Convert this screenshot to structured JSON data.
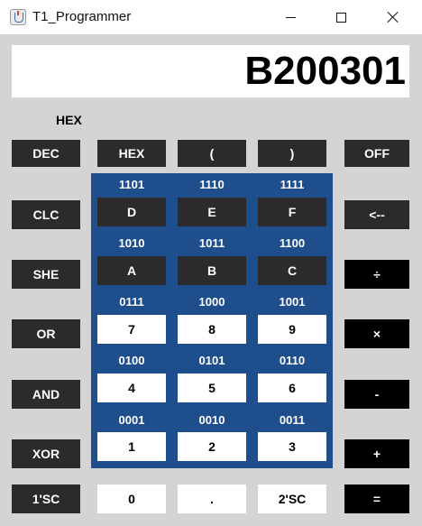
{
  "window": {
    "title": "T1_Programmer",
    "minimize_label": "minimize",
    "maximize_label": "maximize",
    "close_label": "close"
  },
  "display": {
    "value": "B200301"
  },
  "mode_label": "HEX",
  "top_row": {
    "dec": "DEC",
    "hex": "HEX",
    "lparen": "(",
    "rparen": ")",
    "off": "OFF"
  },
  "left_column": {
    "clc": "CLC",
    "she": "SHE",
    "or": "OR",
    "and": "AND",
    "xor": "XOR",
    "ones_complement": "1'SC"
  },
  "right_column": {
    "back": "<--",
    "divide": "÷",
    "multiply": "×",
    "minus": "-",
    "plus": "+",
    "equals": "="
  },
  "keypad": {
    "rows": [
      {
        "bins": [
          "1101",
          "1110",
          "1111"
        ],
        "keys": [
          "D",
          "E",
          "F"
        ]
      },
      {
        "bins": [
          "1010",
          "1011",
          "1100"
        ],
        "keys": [
          "A",
          "B",
          "C"
        ]
      },
      {
        "bins": [
          "0111",
          "1000",
          "1001"
        ],
        "keys": [
          "7",
          "8",
          "9"
        ]
      },
      {
        "bins": [
          "0100",
          "0101",
          "0110"
        ],
        "keys": [
          "4",
          "5",
          "6"
        ]
      },
      {
        "bins": [
          "0001",
          "0010",
          "0011"
        ],
        "keys": [
          "1",
          "2",
          "3"
        ]
      }
    ]
  },
  "bottom_row": {
    "zero": "0",
    "dot": ".",
    "twos_complement": "2'SC"
  },
  "colors": {
    "panel": "#1f4e8c",
    "dark_key": "#2b2b2b",
    "background": "#d4d4d4"
  }
}
